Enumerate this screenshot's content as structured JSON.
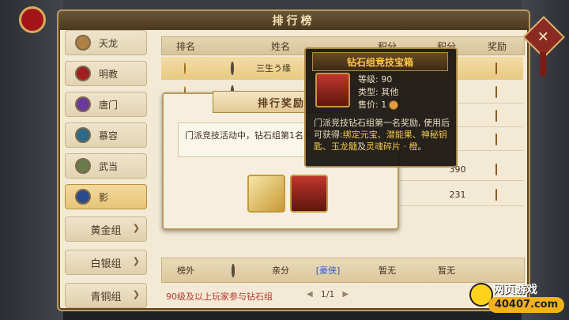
{
  "window": {
    "title": "排行榜"
  },
  "sidebar": {
    "sects": [
      {
        "label": "天龙",
        "color": "#b08040"
      },
      {
        "label": "明教",
        "color": "#a02020"
      },
      {
        "label": "唐门",
        "color": "#6a3a9a"
      },
      {
        "label": "慕容",
        "color": "#2a6a8a"
      },
      {
        "label": "武当",
        "color": "#6a7a4a"
      },
      {
        "label": "影",
        "color": "#2a4a8a"
      }
    ],
    "groups": [
      {
        "label": "黄金组"
      },
      {
        "label": "白银组"
      },
      {
        "label": "青铜组"
      }
    ]
  },
  "table": {
    "headers": [
      "排名",
      "姓名",
      "积分",
      "积分",
      "奖励"
    ],
    "rows": [
      {
        "name": "三生う缘",
        "score": ""
      },
      {
        "name": "",
        "score": ""
      },
      {
        "name": "",
        "score": ""
      },
      {
        "name": "",
        "score": ""
      },
      {
        "name": "",
        "score": "390"
      },
      {
        "name": "",
        "score": "231"
      }
    ],
    "my_row": {
      "rank": "榜外",
      "name": "亲分",
      "tag": "[豪侠]",
      "score": "暂无",
      "reward": "暂无"
    }
  },
  "reward_popup": {
    "title": "排行奖励",
    "description": "门派竞技活动中，钻石组第1名的奖励"
  },
  "tooltip": {
    "title": "钻石组竞技宝箱",
    "level_label": "等级: 90",
    "type_label": "类型: 其他",
    "price_label": "售价: 1",
    "desc_prefix": "门派竞技钻石组第一名奖励, 使用后可获得:",
    "desc_highlight": "绑定元宝、潜能果、神秘钥匙、玉龙髓",
    "desc_mid": "及",
    "desc_highlight2": "灵魂碎片 · 橙",
    "desc_suffix": "。"
  },
  "footer": {
    "notice": "90级及以上玩家参与钻石组",
    "page": "1/1"
  },
  "logo": {
    "line1": "网页游戏",
    "line2": "40407.com"
  }
}
